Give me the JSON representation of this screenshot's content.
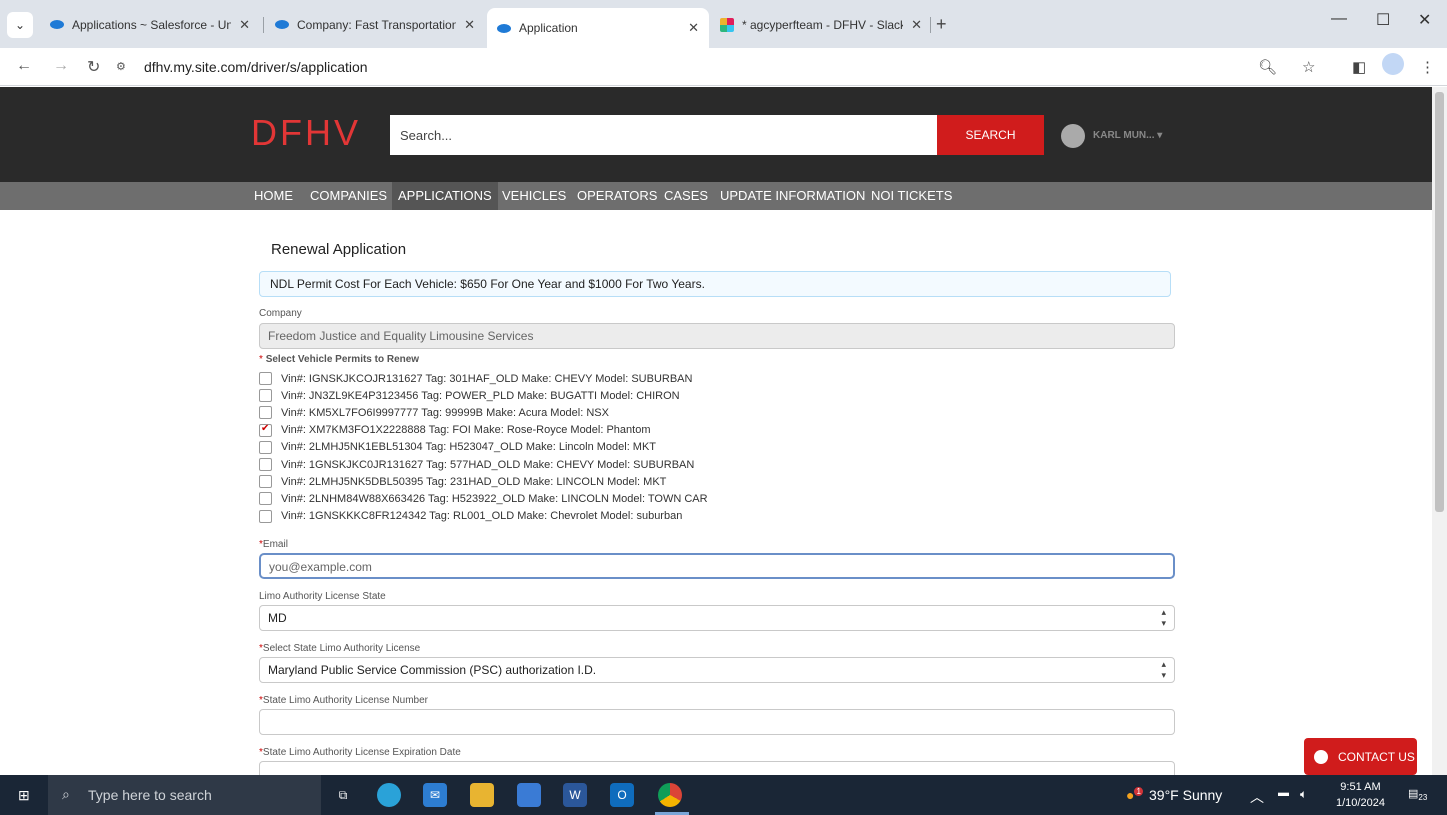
{
  "browser": {
    "tabs": [
      {
        "title": "Applications ~ Salesforce - Unli",
        "favicon": "salesforce-icon"
      },
      {
        "title": "Company: Fast Transportation S",
        "favicon": "salesforce-icon"
      },
      {
        "title": "Application",
        "favicon": "salesforce-icon"
      },
      {
        "title": "* agcyperfteam - DFHV - Slack",
        "favicon": "slack-icon"
      }
    ],
    "url": "dfhv.my.site.com/driver/s/application"
  },
  "header": {
    "logo": "DFHV",
    "search_placeholder": "Search...",
    "search_button": "SEARCH",
    "user_name": "KARL MUN..."
  },
  "nav": [
    "HOME",
    "COMPANIES",
    "APPLICATIONS",
    "VEHICLES",
    "OPERATORS",
    "CASES",
    "UPDATE INFORMATION",
    "NOI TICKETS"
  ],
  "form": {
    "title": "Renewal Application",
    "note": "NDL Permit Cost For Each Vehicle: $650 For One Year and $1000 For Two Years.",
    "company_label": "Company",
    "company_value": "Freedom Justice and Equality Limousine Services",
    "permits_label": "Select Vehicle Permits to Renew",
    "vehicles": [
      {
        "text": "Vin#: IGNSKJKCOJR131627 Tag: 301HAF_OLD Make: CHEVY Model: SUBURBAN",
        "checked": false
      },
      {
        "text": "Vin#: JN3ZL9KE4P3123456 Tag: POWER_PLD Make: BUGATTI Model: CHIRON",
        "checked": false
      },
      {
        "text": "Vin#: KM5XL7FO6I9997777 Tag: 99999B Make: Acura Model: NSX",
        "checked": false
      },
      {
        "text": "Vin#: XM7KM3FO1X2228888 Tag: FOI Make: Rose-Royce Model: Phantom",
        "checked": true
      },
      {
        "text": "Vin#: 2LMHJ5NK1EBL51304 Tag: H523047_OLD Make: Lincoln Model: MKT",
        "checked": false
      },
      {
        "text": "Vin#: 1GNSKJKC0JR131627 Tag: 577HAD_OLD Make: CHEVY Model: SUBURBAN",
        "checked": false
      },
      {
        "text": "Vin#: 2LMHJ5NK5DBL50395 Tag: 231HAD_OLD Make: LINCOLN Model: MKT",
        "checked": false
      },
      {
        "text": "Vin#: 2LNHM84W88X663426 Tag: H523922_OLD Make: LINCOLN Model: TOWN CAR",
        "checked": false
      },
      {
        "text": "Vin#: 1GNSKKKC8FR124342 Tag: RL001_OLD Make: Chevrolet Model: suburban",
        "checked": false
      }
    ],
    "email_label": "Email",
    "email_placeholder": "you@example.com",
    "limo_state_label": "Limo Authority License State",
    "limo_state_value": "MD",
    "state_license_label": "Select State Limo Authority License",
    "state_license_value": "Maryland Public Service Commission (PSC) authorization I.D.",
    "license_number_label": "State Limo Authority License Number",
    "license_number_value": "",
    "expiration_label": "State Limo Authority License Expiration Date",
    "required_mark": "*"
  },
  "contact_button": "CONTACT US",
  "taskbar": {
    "search_placeholder": "Type here to search",
    "weather": "39°F Sunny",
    "time": "9:51 AM",
    "date": "1/10/2024",
    "notifications": "23",
    "weather_badge": "1"
  }
}
